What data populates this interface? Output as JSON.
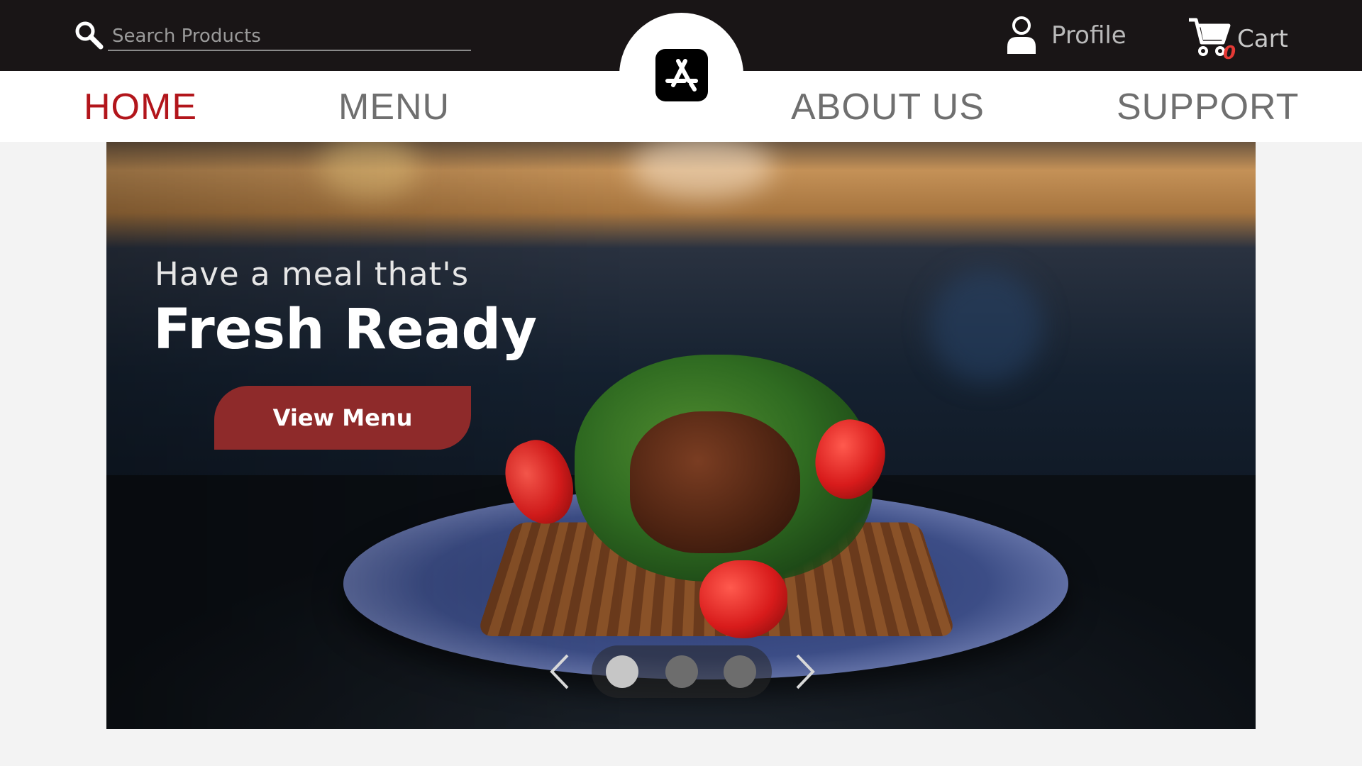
{
  "header": {
    "search": {
      "placeholder": "Search Products",
      "value": ""
    },
    "profile_label": "Profile",
    "cart_label": "Cart",
    "cart_count": "0"
  },
  "nav": {
    "items": [
      {
        "label": "HOME",
        "active": true
      },
      {
        "label": "MENU",
        "active": false
      },
      {
        "label": "ABOUT US",
        "active": false
      },
      {
        "label": "SUPPORT",
        "active": false
      }
    ],
    "logo_icon": "app-store-icon"
  },
  "hero": {
    "subtitle": "Have a meal that's",
    "title": "Fresh Ready",
    "cta_label": "View Menu",
    "carousel": {
      "slides": 3,
      "active_index": 0
    }
  },
  "colors": {
    "topbar": "#191516",
    "nav_active": "#b2151b",
    "nav_inactive": "#6f6f6f",
    "cta": "#8e2a2a",
    "cart_badge": "#e53935"
  }
}
